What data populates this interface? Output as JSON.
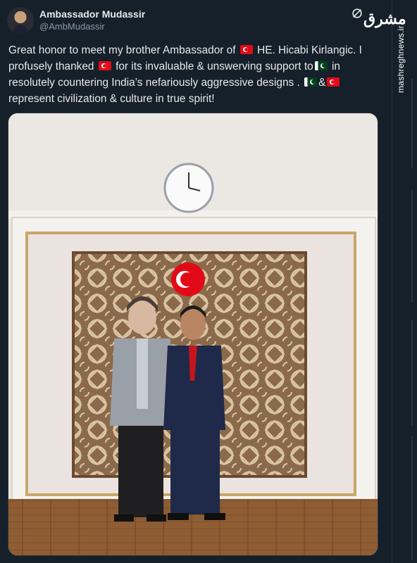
{
  "tweet": {
    "display_name": "Ambassador Mudassir",
    "handle": "@AmbMudassir",
    "text": {
      "p1": "Great honor to meet my brother Ambassador of",
      "p2": "HE. Hicabi Kirlangic. I profusely thanked",
      "p3": "for its invaluable & unswerving support to",
      "p4": "in resolutely countering India’s nefariously aggressive designs .",
      "p5": "&",
      "p6": "represent civilization & culture in true spirit!"
    },
    "icons": {
      "grok": "grok-icon",
      "flag_turkey": "turkey-flag-icon",
      "flag_pakistan": "pakistan-flag-icon"
    }
  },
  "watermark": {
    "logo": "مشرق",
    "site": "mashreghnews.ir"
  },
  "colors": {
    "background": "#15202b",
    "text": "#e7e9ea",
    "muted": "#8b98a5",
    "border": "#2f3336"
  }
}
